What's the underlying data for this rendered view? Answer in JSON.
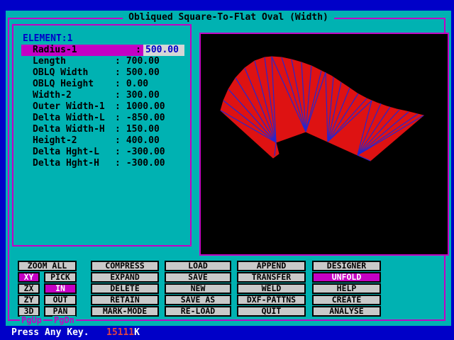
{
  "window": {
    "title": "Obliqued Square-To-Flat Oval (Width)"
  },
  "colors": {
    "background_blue": "#0000C8",
    "panel_teal": "#00B2B2",
    "accent_magenta": "#C400C4",
    "button_gray": "#C9C9C9",
    "field_gray": "#D6D6D6",
    "text_blue": "#0000C8",
    "memory_red": "#E04444",
    "shape_red": "#DE1212",
    "wire_blue": "#2626D0"
  },
  "parameters": {
    "element_label": "ELEMENT:1",
    "rows": [
      {
        "label": "Radius-1",
        "sep": ":",
        "value": "500.00",
        "selected": true
      },
      {
        "label": "Length",
        "sep": ":",
        "value": "700.00"
      },
      {
        "label": "OBLQ Width",
        "sep": ":",
        "value": "500.00"
      },
      {
        "label": "OBLQ Height",
        "sep": ":",
        "value": "0.00"
      },
      {
        "label": "Width-2",
        "sep": ":",
        "value": "300.00"
      },
      {
        "label": "Outer Width-1",
        "sep": ":",
        "value": "1000.00"
      },
      {
        "label": "Delta Width-L",
        "sep": ":",
        "value": "-850.00"
      },
      {
        "label": "Delta Width-H",
        "sep": ":",
        "value": "150.00"
      },
      {
        "label": "Height-2",
        "sep": ":",
        "value": "400.00"
      },
      {
        "label": "Delta Hght-L",
        "sep": ":",
        "value": "-300.00"
      },
      {
        "label": "Delta Hght-H",
        "sep": ":",
        "value": "-300.00"
      }
    ]
  },
  "viewport": {
    "shape_fill": "#DE1212",
    "wire_color": "#2626D0",
    "outline": [
      [
        28,
        108
      ],
      [
        32,
        94
      ],
      [
        39,
        78
      ],
      [
        49,
        62
      ],
      [
        62,
        48
      ],
      [
        76,
        38
      ],
      [
        90,
        33
      ],
      [
        100,
        32
      ],
      [
        114,
        33
      ],
      [
        128,
        36
      ],
      [
        142,
        40
      ],
      [
        156,
        45
      ],
      [
        170,
        52
      ],
      [
        184,
        59
      ],
      [
        196,
        67
      ],
      [
        208,
        75
      ],
      [
        221,
        84
      ],
      [
        234,
        91
      ],
      [
        248,
        97
      ],
      [
        262,
        102
      ],
      [
        276,
        106
      ],
      [
        290,
        109
      ],
      [
        302,
        112
      ],
      [
        314,
        115
      ],
      [
        239,
        179
      ],
      [
        221,
        171
      ],
      [
        179,
        152
      ],
      [
        148,
        138
      ],
      [
        106,
        153
      ],
      [
        110,
        169
      ],
      [
        102,
        175
      ]
    ],
    "fans": [
      {
        "apex": [
          106,
          153
        ],
        "targets": [
          [
            28,
            108
          ],
          [
            32,
            94
          ],
          [
            39,
            78
          ],
          [
            49,
            62
          ],
          [
            62,
            48
          ],
          [
            76,
            38
          ],
          [
            90,
            33
          ],
          [
            100,
            32
          ],
          [
            104,
            172
          ]
        ]
      },
      {
        "apex": [
          148,
          138
        ],
        "targets": [
          [
            100,
            32
          ],
          [
            114,
            33
          ],
          [
            128,
            36
          ],
          [
            142,
            40
          ],
          [
            156,
            45
          ],
          [
            170,
            52
          ],
          [
            176,
            54
          ]
        ]
      },
      {
        "apex": [
          179,
          152
        ],
        "targets": [
          [
            176,
            54
          ],
          [
            187,
            61
          ],
          [
            198,
            68
          ],
          [
            210,
            76
          ],
          [
            222,
            84
          ],
          [
            234,
            91
          ],
          [
            241,
            94
          ]
        ]
      },
      {
        "apex": [
          221,
          171
        ],
        "targets": [
          [
            241,
            94
          ],
          [
            254,
            98
          ],
          [
            267,
            103
          ],
          [
            280,
            107
          ],
          [
            293,
            110
          ],
          [
            306,
            113
          ],
          [
            314,
            115
          ],
          [
            239,
            179
          ]
        ]
      }
    ]
  },
  "buttons": {
    "zoom_all": "ZOOM ALL",
    "axis": [
      "XY",
      "ZX",
      "ZY",
      "3D"
    ],
    "mode": [
      "PICK",
      "IN",
      "OUT",
      "PAN"
    ],
    "edit": [
      "COMPRESS",
      "EXPAND",
      "DELETE",
      "RETAIN",
      "MARK-MODE"
    ],
    "file": [
      "LOAD",
      "SAVE",
      "NEW",
      "SAVE AS",
      "RE-LOAD"
    ],
    "ops": [
      "APPEND",
      "TRANSFER",
      "WELD",
      "DXF-PATTNS",
      "QUIT"
    ],
    "tools": [
      "DESIGNER",
      "UNFOLD",
      "HELP",
      "CREATE",
      "ANALYSE"
    ],
    "active_buttons": [
      "XY",
      "IN",
      "UNFOLD"
    ]
  },
  "pager": {
    "pgup": "PgUp",
    "pgdn": "PgDn"
  },
  "statusbar": {
    "press_any_key": "Press Any Key.",
    "memory_value": "15111",
    "memory_unit": "K"
  }
}
